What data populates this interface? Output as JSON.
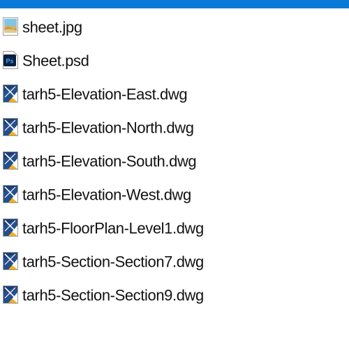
{
  "selection_color": "#0a78d7",
  "files": [
    {
      "name": "sheet.jpg",
      "icon": "image-file-icon"
    },
    {
      "name": "Sheet.psd",
      "icon": "photoshop-file-icon"
    },
    {
      "name": "tarh5-Elevation-East.dwg",
      "icon": "dwg-file-icon"
    },
    {
      "name": "tarh5-Elevation-North.dwg",
      "icon": "dwg-file-icon"
    },
    {
      "name": "tarh5-Elevation-South.dwg",
      "icon": "dwg-file-icon"
    },
    {
      "name": "tarh5-Elevation-West.dwg",
      "icon": "dwg-file-icon"
    },
    {
      "name": "tarh5-FloorPlan-Level1.dwg",
      "icon": "dwg-file-icon"
    },
    {
      "name": "tarh5-Section-Section7.dwg",
      "icon": "dwg-file-icon"
    },
    {
      "name": "tarh5-Section-Section9.dwg",
      "icon": "dwg-file-icon"
    }
  ]
}
